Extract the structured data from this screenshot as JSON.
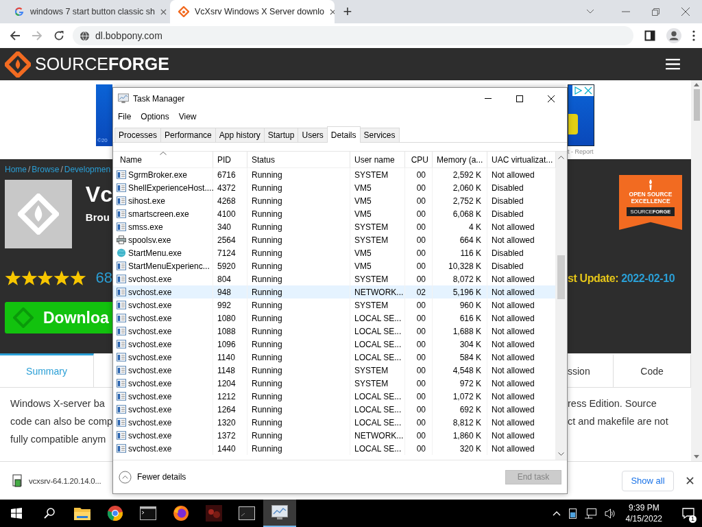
{
  "browser": {
    "tabs": [
      {
        "title": "windows 7 start button classic sh",
        "kind": "search",
        "selected": false
      },
      {
        "title": "VcXsrv Windows X Server downlo",
        "kind": "site",
        "selected": true
      }
    ],
    "new_tab": "+",
    "url": "dl.bobpony.com",
    "forward_disabled": true
  },
  "site": {
    "logo_light": "SOURCE",
    "logo_bold": "FORGE",
    "ad": {
      "mark": "©20",
      "report": "t - Report"
    },
    "breadcrumb": [
      {
        "text": "Home",
        "kind": "link"
      },
      {
        "text": "/",
        "kind": "sep"
      },
      {
        "text": "Browse",
        "kind": "link"
      },
      {
        "text": "/",
        "kind": "sep"
      },
      {
        "text": "Developmen",
        "kind": "link"
      }
    ],
    "title": "Vc",
    "subtitle": "Brou",
    "stars": 5,
    "rating": "68",
    "download": "Downloa",
    "update_label": "st Update:",
    "update_date": "2022-02-10",
    "badge": {
      "line1": "OPEN SOURCE",
      "line2": "EXCELLENCE",
      "brand_light": "SOURCE",
      "brand_bold": "FORGE"
    },
    "tabs_left": [
      {
        "label": "Summary",
        "selected": true
      }
    ],
    "tabs_right": [
      {
        "label": "ssion",
        "selected": false
      },
      {
        "label": "Code",
        "selected": false
      }
    ],
    "description_left": [
      "Windows X-server ba",
      "code can also be comp",
      "fully compatible anym"
    ],
    "description_right": [
      "ress Edition. Source",
      "ct and makefile are not"
    ]
  },
  "task_manager": {
    "title": "Task Manager",
    "menu": [
      "File",
      "Options",
      "View"
    ],
    "tabs": [
      {
        "label": "Processes",
        "selected": false
      },
      {
        "label": "Performance",
        "selected": false
      },
      {
        "label": "App history",
        "selected": false
      },
      {
        "label": "Startup",
        "selected": false
      },
      {
        "label": "Users",
        "selected": false
      },
      {
        "label": "Details",
        "selected": true
      },
      {
        "label": "Services",
        "selected": false
      }
    ],
    "columns": [
      "Name",
      "PID",
      "Status",
      "User name",
      "CPU",
      "Memory (a...",
      "UAC virtualizat..."
    ],
    "rows": [
      {
        "name": "SgrmBroker.exe",
        "kind": "app",
        "pid": "6716",
        "status": "Running",
        "user": "SYSTEM",
        "cpu": "00",
        "memory": "2,592 K",
        "uac": "Not allowed",
        "selected": false
      },
      {
        "name": "ShellExperienceHost....",
        "kind": "app",
        "pid": "4372",
        "status": "Running",
        "user": "VM5",
        "cpu": "00",
        "memory": "2,060 K",
        "uac": "Disabled",
        "selected": false
      },
      {
        "name": "sihost.exe",
        "kind": "app",
        "pid": "4268",
        "status": "Running",
        "user": "VM5",
        "cpu": "00",
        "memory": "2,752 K",
        "uac": "Disabled",
        "selected": false
      },
      {
        "name": "smartscreen.exe",
        "kind": "app",
        "pid": "4100",
        "status": "Running",
        "user": "VM5",
        "cpu": "00",
        "memory": "6,068 K",
        "uac": "Disabled",
        "selected": false
      },
      {
        "name": "smss.exe",
        "kind": "app",
        "pid": "340",
        "status": "Running",
        "user": "SYSTEM",
        "cpu": "00",
        "memory": "4 K",
        "uac": "Not allowed",
        "selected": false
      },
      {
        "name": "spoolsv.exe",
        "kind": "printer",
        "pid": "2564",
        "status": "Running",
        "user": "SYSTEM",
        "cpu": "00",
        "memory": "664 K",
        "uac": "Not allowed",
        "selected": false
      },
      {
        "name": "StartMenu.exe",
        "kind": "globe",
        "pid": "7124",
        "status": "Running",
        "user": "VM5",
        "cpu": "00",
        "memory": "116 K",
        "uac": "Disabled",
        "selected": false
      },
      {
        "name": "StartMenuExperienc...",
        "kind": "app",
        "pid": "5920",
        "status": "Running",
        "user": "VM5",
        "cpu": "00",
        "memory": "10,328 K",
        "uac": "Disabled",
        "selected": false
      },
      {
        "name": "svchost.exe",
        "kind": "app",
        "pid": "804",
        "status": "Running",
        "user": "SYSTEM",
        "cpu": "00",
        "memory": "8,072 K",
        "uac": "Not allowed",
        "selected": false
      },
      {
        "name": "svchost.exe",
        "kind": "app",
        "pid": "948",
        "status": "Running",
        "user": "NETWORK...",
        "cpu": "02",
        "memory": "5,196 K",
        "uac": "Not allowed",
        "selected": true
      },
      {
        "name": "svchost.exe",
        "kind": "app",
        "pid": "992",
        "status": "Running",
        "user": "SYSTEM",
        "cpu": "00",
        "memory": "960 K",
        "uac": "Not allowed",
        "selected": false
      },
      {
        "name": "svchost.exe",
        "kind": "app",
        "pid": "1080",
        "status": "Running",
        "user": "LOCAL SE...",
        "cpu": "00",
        "memory": "616 K",
        "uac": "Not allowed",
        "selected": false
      },
      {
        "name": "svchost.exe",
        "kind": "app",
        "pid": "1088",
        "status": "Running",
        "user": "LOCAL SE...",
        "cpu": "00",
        "memory": "1,688 K",
        "uac": "Not allowed",
        "selected": false
      },
      {
        "name": "svchost.exe",
        "kind": "app",
        "pid": "1096",
        "status": "Running",
        "user": "LOCAL SE...",
        "cpu": "00",
        "memory": "304 K",
        "uac": "Not allowed",
        "selected": false
      },
      {
        "name": "svchost.exe",
        "kind": "app",
        "pid": "1140",
        "status": "Running",
        "user": "LOCAL SE...",
        "cpu": "00",
        "memory": "584 K",
        "uac": "Not allowed",
        "selected": false
      },
      {
        "name": "svchost.exe",
        "kind": "app",
        "pid": "1148",
        "status": "Running",
        "user": "SYSTEM",
        "cpu": "00",
        "memory": "4,548 K",
        "uac": "Not allowed",
        "selected": false
      },
      {
        "name": "svchost.exe",
        "kind": "app",
        "pid": "1204",
        "status": "Running",
        "user": "SYSTEM",
        "cpu": "00",
        "memory": "972 K",
        "uac": "Not allowed",
        "selected": false
      },
      {
        "name": "svchost.exe",
        "kind": "app",
        "pid": "1212",
        "status": "Running",
        "user": "LOCAL SE...",
        "cpu": "00",
        "memory": "1,072 K",
        "uac": "Not allowed",
        "selected": false
      },
      {
        "name": "svchost.exe",
        "kind": "app",
        "pid": "1264",
        "status": "Running",
        "user": "LOCAL SE...",
        "cpu": "00",
        "memory": "692 K",
        "uac": "Not allowed",
        "selected": false
      },
      {
        "name": "svchost.exe",
        "kind": "app",
        "pid": "1320",
        "status": "Running",
        "user": "LOCAL SE...",
        "cpu": "00",
        "memory": "8,812 K",
        "uac": "Not allowed",
        "selected": false
      },
      {
        "name": "svchost.exe",
        "kind": "app",
        "pid": "1372",
        "status": "Running",
        "user": "NETWORK...",
        "cpu": "00",
        "memory": "1,860 K",
        "uac": "Not allowed",
        "selected": false
      },
      {
        "name": "svchost.exe",
        "kind": "app",
        "pid": "1440",
        "status": "Running",
        "user": "LOCAL SE...",
        "cpu": "00",
        "memory": "320 K",
        "uac": "Not allowed",
        "selected": false
      }
    ],
    "fewer_details": "Fewer details",
    "end_task": {
      "label": "End task",
      "disabled": true
    }
  },
  "download_bar": {
    "file": "vcxsrv-64.1.20.14.0...",
    "show_all": "Show all"
  },
  "taskbar": {
    "time": "9:39 PM",
    "date": "4/15/2022",
    "notifications": "1"
  }
}
